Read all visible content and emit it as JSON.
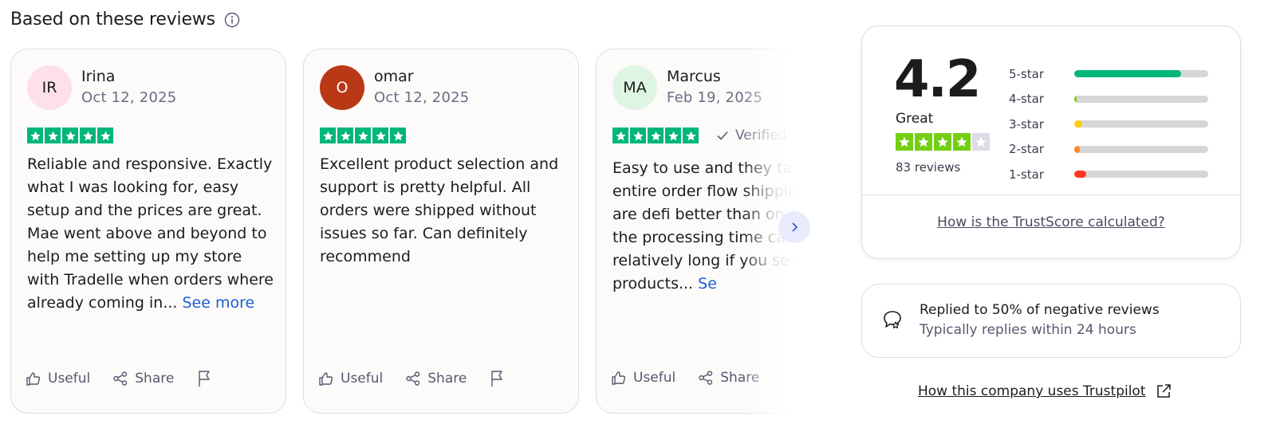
{
  "section": {
    "title": "Based on these reviews",
    "info_icon": "info-icon"
  },
  "reviews": [
    {
      "initials": "IR",
      "avatar_color": "#fde0ea",
      "name": "Irina",
      "date": "Oct 12, 2025",
      "rating": 5,
      "text": "Reliable and responsive. Exactly what I was looking for, easy setup and the prices are great. Mae went above and beyond to help me setting up my store with Tradelle when orders where already coming in...",
      "see_more": "See more",
      "useful_label": "Useful",
      "share_label": "Share"
    },
    {
      "initials": "O",
      "avatar_color": "#b93815",
      "name": "omar",
      "date": "Oct 12, 2025",
      "rating": 5,
      "text": "Excellent product selection and support is pretty helpful. All orders were shipped without issues so far. Can definitely recommend",
      "useful_label": "Useful",
      "share_label": "Share"
    },
    {
      "initials": "MA",
      "avatar_color": "#dff5e4",
      "name": "Marcus",
      "date": "Feb 19, 2025",
      "rating": 5,
      "verified_label": "Verified",
      "text": "Easy to use and they ta of the entire order flow shipping times are defi better than on AliExpre the processing time ca relatively long if you se different products...",
      "see_more": "Se",
      "useful_label": "Useful",
      "share_label": "Share"
    }
  ],
  "summary": {
    "score": "4.2",
    "label": "Great",
    "stars": 4,
    "review_count": "83 reviews",
    "distribution": [
      {
        "label": "5-star",
        "fraction": 0.8,
        "color": "#00b67a"
      },
      {
        "label": "4-star",
        "fraction": 0.02,
        "color": "#73cf11"
      },
      {
        "label": "3-star",
        "fraction": 0.06,
        "color": "#ffce00"
      },
      {
        "label": "2-star",
        "fraction": 0.04,
        "color": "#ff8622"
      },
      {
        "label": "1-star",
        "fraction": 0.09,
        "color": "#ff3722"
      }
    ],
    "link": "How is the TrustScore calculated?"
  },
  "replies": {
    "primary": "Replied to 50% of negative reviews",
    "secondary": "Typically replies within 24 hours"
  },
  "company_link": "How this company uses Trustpilot",
  "colors": {
    "trustpilot_green": "#00b67a",
    "link_blue": "#1b5fd6",
    "muted": "#6c6c85"
  }
}
